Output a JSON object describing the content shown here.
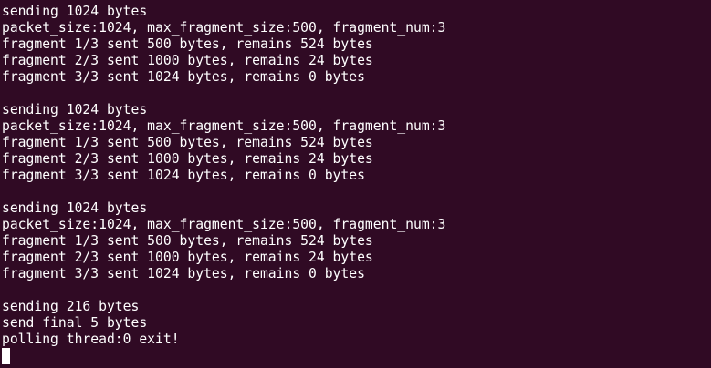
{
  "terminal": {
    "lines": [
      "sending 1024 bytes",
      "packet_size:1024, max_fragment_size:500, fragment_num:3",
      "fragment 1/3 sent 500 bytes, remains 524 bytes",
      "fragment 2/3 sent 1000 bytes, remains 24 bytes",
      "fragment 3/3 sent 1024 bytes, remains 0 bytes",
      "",
      "sending 1024 bytes",
      "packet_size:1024, max_fragment_size:500, fragment_num:3",
      "fragment 1/3 sent 500 bytes, remains 524 bytes",
      "fragment 2/3 sent 1000 bytes, remains 24 bytes",
      "fragment 3/3 sent 1024 bytes, remains 0 bytes",
      "",
      "sending 1024 bytes",
      "packet_size:1024, max_fragment_size:500, fragment_num:3",
      "fragment 1/3 sent 500 bytes, remains 524 bytes",
      "fragment 2/3 sent 1000 bytes, remains 24 bytes",
      "fragment 3/3 sent 1024 bytes, remains 0 bytes",
      "",
      "sending 216 bytes",
      "send final 5 bytes",
      "polling thread:0 exit!"
    ]
  }
}
